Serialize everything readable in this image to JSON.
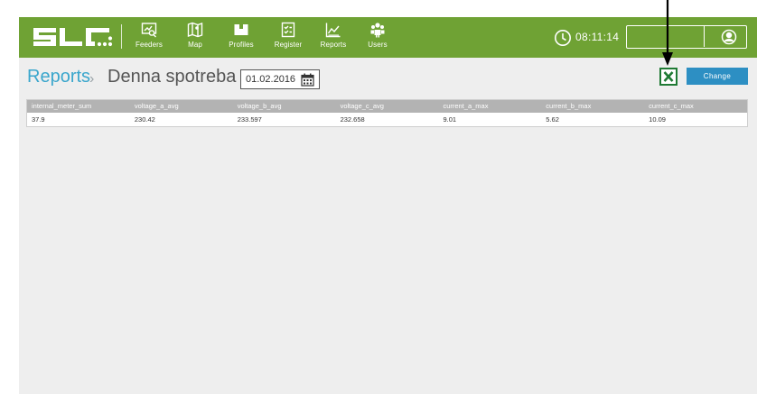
{
  "header": {
    "logo_alt": "SLC",
    "nav": [
      {
        "label": "Feeders",
        "icon": "feeders-icon"
      },
      {
        "label": "Map",
        "icon": "map-icon"
      },
      {
        "label": "Profiles",
        "icon": "profiles-icon"
      },
      {
        "label": "Register",
        "icon": "register-icon"
      },
      {
        "label": "Reports",
        "icon": "reports-icon"
      },
      {
        "label": "Users",
        "icon": "users-icon"
      }
    ],
    "time": "08:11:14",
    "username_value": ""
  },
  "page": {
    "breadcrumb": "Reports",
    "separator": "›",
    "title": "Denna spotreba",
    "date": "01.02.2016",
    "change_label": "Change"
  },
  "table": {
    "columns": [
      "internal_meter_sum",
      "voltage_a_avg",
      "voltage_b_avg",
      "voltage_c_avg",
      "current_a_max",
      "current_b_max",
      "current_c_max"
    ],
    "rows": [
      [
        "37.9",
        "230.42",
        "233.597",
        "232.658",
        "9.01",
        "5.62",
        "10.09"
      ]
    ]
  },
  "colors": {
    "header_green": "#6fa234",
    "accent_blue": "#2d8fc3",
    "breadcrumb_blue": "#3aa6cc",
    "excel_green": "#1f7a34"
  }
}
